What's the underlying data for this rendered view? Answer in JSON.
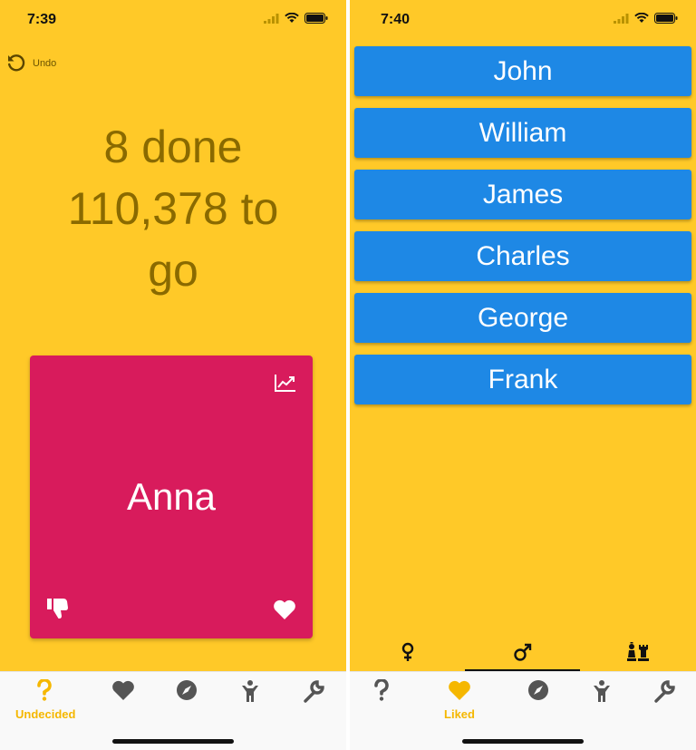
{
  "left_screen": {
    "status_time": "7:39",
    "undo_label": "Undo",
    "progress": {
      "done": "8 done",
      "to_go_line1": "110,378 to",
      "to_go_line2": "go"
    },
    "card": {
      "name": "Anna",
      "color": "#D81B5C"
    },
    "tabs": [
      {
        "label": "Undecided",
        "icon": "question-icon",
        "active": true
      },
      {
        "label": "",
        "icon": "heart-icon",
        "active": false
      },
      {
        "label": "",
        "icon": "compass-icon",
        "active": false
      },
      {
        "label": "",
        "icon": "person-icon",
        "active": false
      },
      {
        "label": "",
        "icon": "wrench-icon",
        "active": false
      }
    ]
  },
  "right_screen": {
    "status_time": "7:40",
    "names": [
      "John",
      "William",
      "James",
      "Charles",
      "George",
      "Frank"
    ],
    "gender_tabs": [
      {
        "icon": "female-icon",
        "active": false
      },
      {
        "icon": "male-icon",
        "active": true
      },
      {
        "icon": "chess-icon",
        "active": false
      }
    ],
    "tabs": [
      {
        "label": "",
        "icon": "question-icon",
        "active": false
      },
      {
        "label": "Liked",
        "icon": "heart-icon",
        "active": true
      },
      {
        "label": "",
        "icon": "compass-icon",
        "active": false
      },
      {
        "label": "",
        "icon": "person-icon",
        "active": false
      },
      {
        "label": "",
        "icon": "wrench-icon",
        "active": false
      }
    ]
  },
  "colors": {
    "background": "#FFC928",
    "progress_text": "#8a6a00",
    "card": "#D81B5C",
    "name_button": "#1E88E5",
    "tab_active": "#F5B700",
    "tab_inactive": "#555555"
  }
}
